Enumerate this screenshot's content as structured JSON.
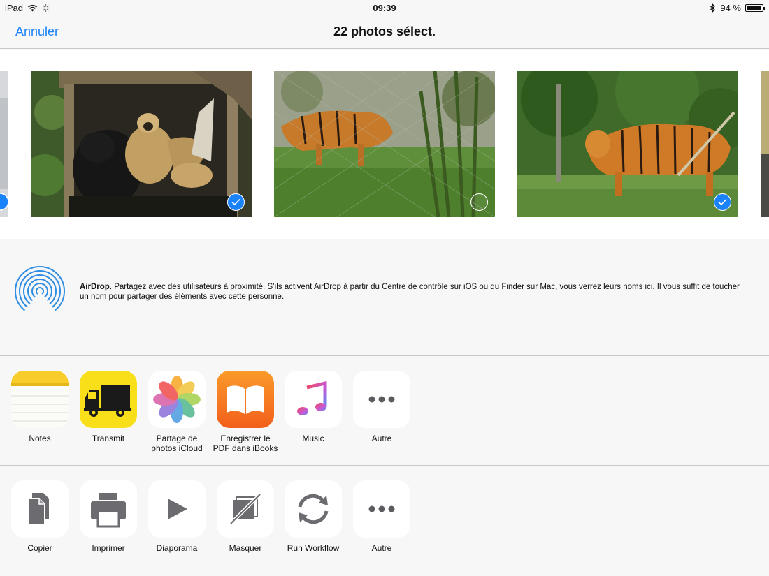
{
  "status": {
    "device": "iPad",
    "time": "09:39",
    "battery": "94 %",
    "battery_level": 0.94
  },
  "nav": {
    "cancel": "Annuler",
    "title": "22 photos sélect."
  },
  "photos": [
    {
      "subject": "gibbons",
      "selected": true
    },
    {
      "subject": "tiger",
      "selected": false
    },
    {
      "subject": "tiger",
      "selected": true
    }
  ],
  "airdrop": {
    "title": "AirDrop",
    "text": ". Partagez avec des utilisateurs à proximité. S’ils activent AirDrop à partir du Centre de contrôle sur iOS ou du Finder sur Mac, vous verrez leurs noms ici. Il vous suffit de toucher un nom pour partager des éléments avec cette personne."
  },
  "share_apps": [
    {
      "label": "Notes",
      "icon": "notes-icon"
    },
    {
      "label": "Transmit",
      "icon": "truck-icon"
    },
    {
      "label": "Partage de photos iCloud",
      "icon": "photos-icon"
    },
    {
      "label": "Enregistrer le PDF dans iBooks",
      "icon": "ibooks-icon"
    },
    {
      "label": "Music",
      "icon": "music-icon"
    },
    {
      "label": "Autre",
      "icon": "more-icon"
    }
  ],
  "actions": [
    {
      "label": "Copier",
      "icon": "copy-icon"
    },
    {
      "label": "Imprimer",
      "icon": "printer-icon"
    },
    {
      "label": "Diaporama",
      "icon": "play-icon"
    },
    {
      "label": "Masquer",
      "icon": "hide-icon"
    },
    {
      "label": "Run Workflow",
      "icon": "workflow-icon"
    },
    {
      "label": "Autre",
      "icon": "more-icon"
    }
  ],
  "colors": {
    "accent": "#1a82fb",
    "background": "#f7f7f7",
    "separator": "#c8c8c8",
    "action_glyph": "#6b6b70"
  }
}
